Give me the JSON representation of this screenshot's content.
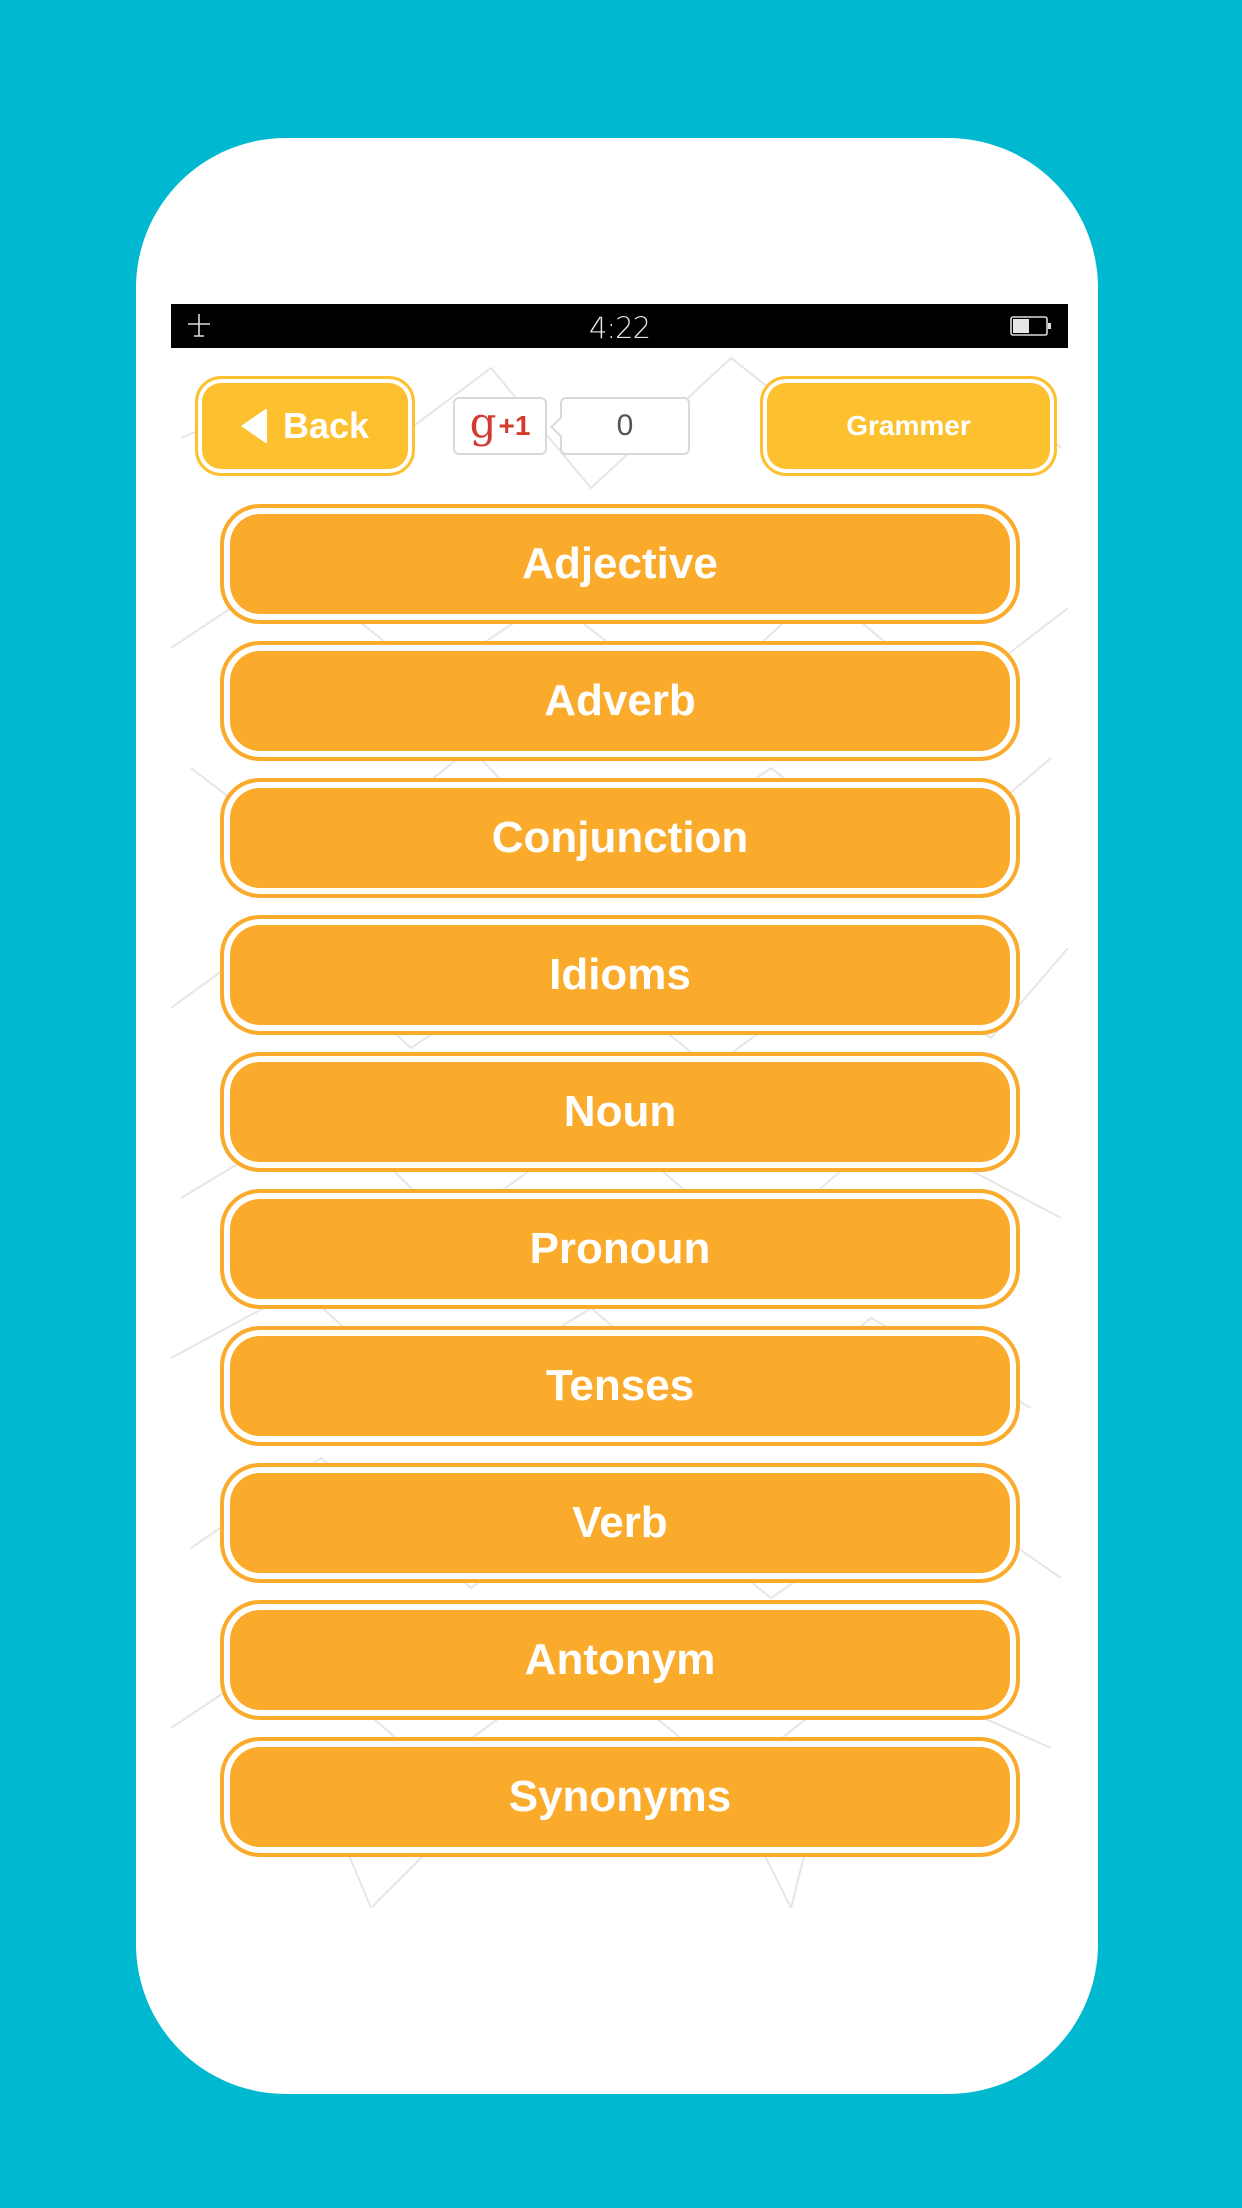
{
  "status_bar": {
    "time": "4:22",
    "left_icon": "airplane-mode-icon",
    "right_icon": "battery-icon",
    "battery_level": 0.5
  },
  "top_bar": {
    "back_label": "Back",
    "back_icon": "back-arrow-icon",
    "gplus_label": "+1",
    "gplus_glyph": "g",
    "gplus_count": "0",
    "category_label": "Grammer"
  },
  "menu": {
    "items": [
      {
        "label": "Adjective"
      },
      {
        "label": "Adverb"
      },
      {
        "label": "Conjunction"
      },
      {
        "label": "Idioms"
      },
      {
        "label": "Noun"
      },
      {
        "label": "Pronoun"
      },
      {
        "label": "Tenses"
      },
      {
        "label": "Verb"
      },
      {
        "label": "Antonym"
      },
      {
        "label": "Synonyms"
      }
    ]
  },
  "colors": {
    "background": "#00b8cf",
    "button_orange": "#fbab2c",
    "topbar_yellow": "#fdc130",
    "gplus_red": "#d33b2f"
  }
}
